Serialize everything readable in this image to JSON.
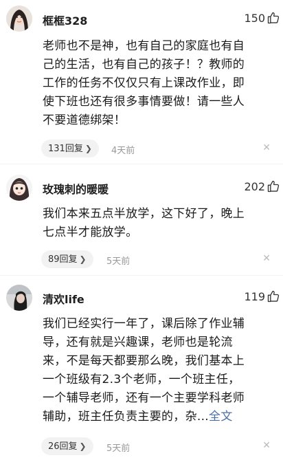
{
  "comments": [
    {
      "username": "框框328",
      "likes": "150",
      "lines": [
        "老师也不是神，也有自己的家庭也有自",
        "己的生活，也有自己的孩子！？教师的",
        "工作的任务不仅仅只有上课改作业，即",
        "使下班也还有很多事情要做！请一些人",
        "不要道德绑架！"
      ],
      "replies": "131回复",
      "time": "4天前"
    },
    {
      "username": "玫瑰刺的暖暖",
      "likes": "202",
      "lines": [
        "我们本来五点半放学，这下好了，晚上",
        "七点半才能放学。"
      ],
      "replies": "89回复",
      "time": "5天前"
    },
    {
      "username": "清欢life",
      "likes": "119",
      "lines": [
        "我们已经实行一年了，课后除了作业辅",
        "导，还有就是兴趣课，老师也是轮流",
        "来，不是每天都要那么晚，我们基本上",
        "一个班级有2.3个老师，一个班主任，",
        "一个辅导老师，还有一个主要学科老师",
        "辅助，班主任负责主要的，杂..."
      ],
      "expand_link": "全文",
      "replies": "26回复",
      "time": "5天前"
    }
  ],
  "icons": {
    "like": "thumbs-up-outline-icon",
    "close": "close-icon",
    "chevron": "chevron-right-icon"
  }
}
